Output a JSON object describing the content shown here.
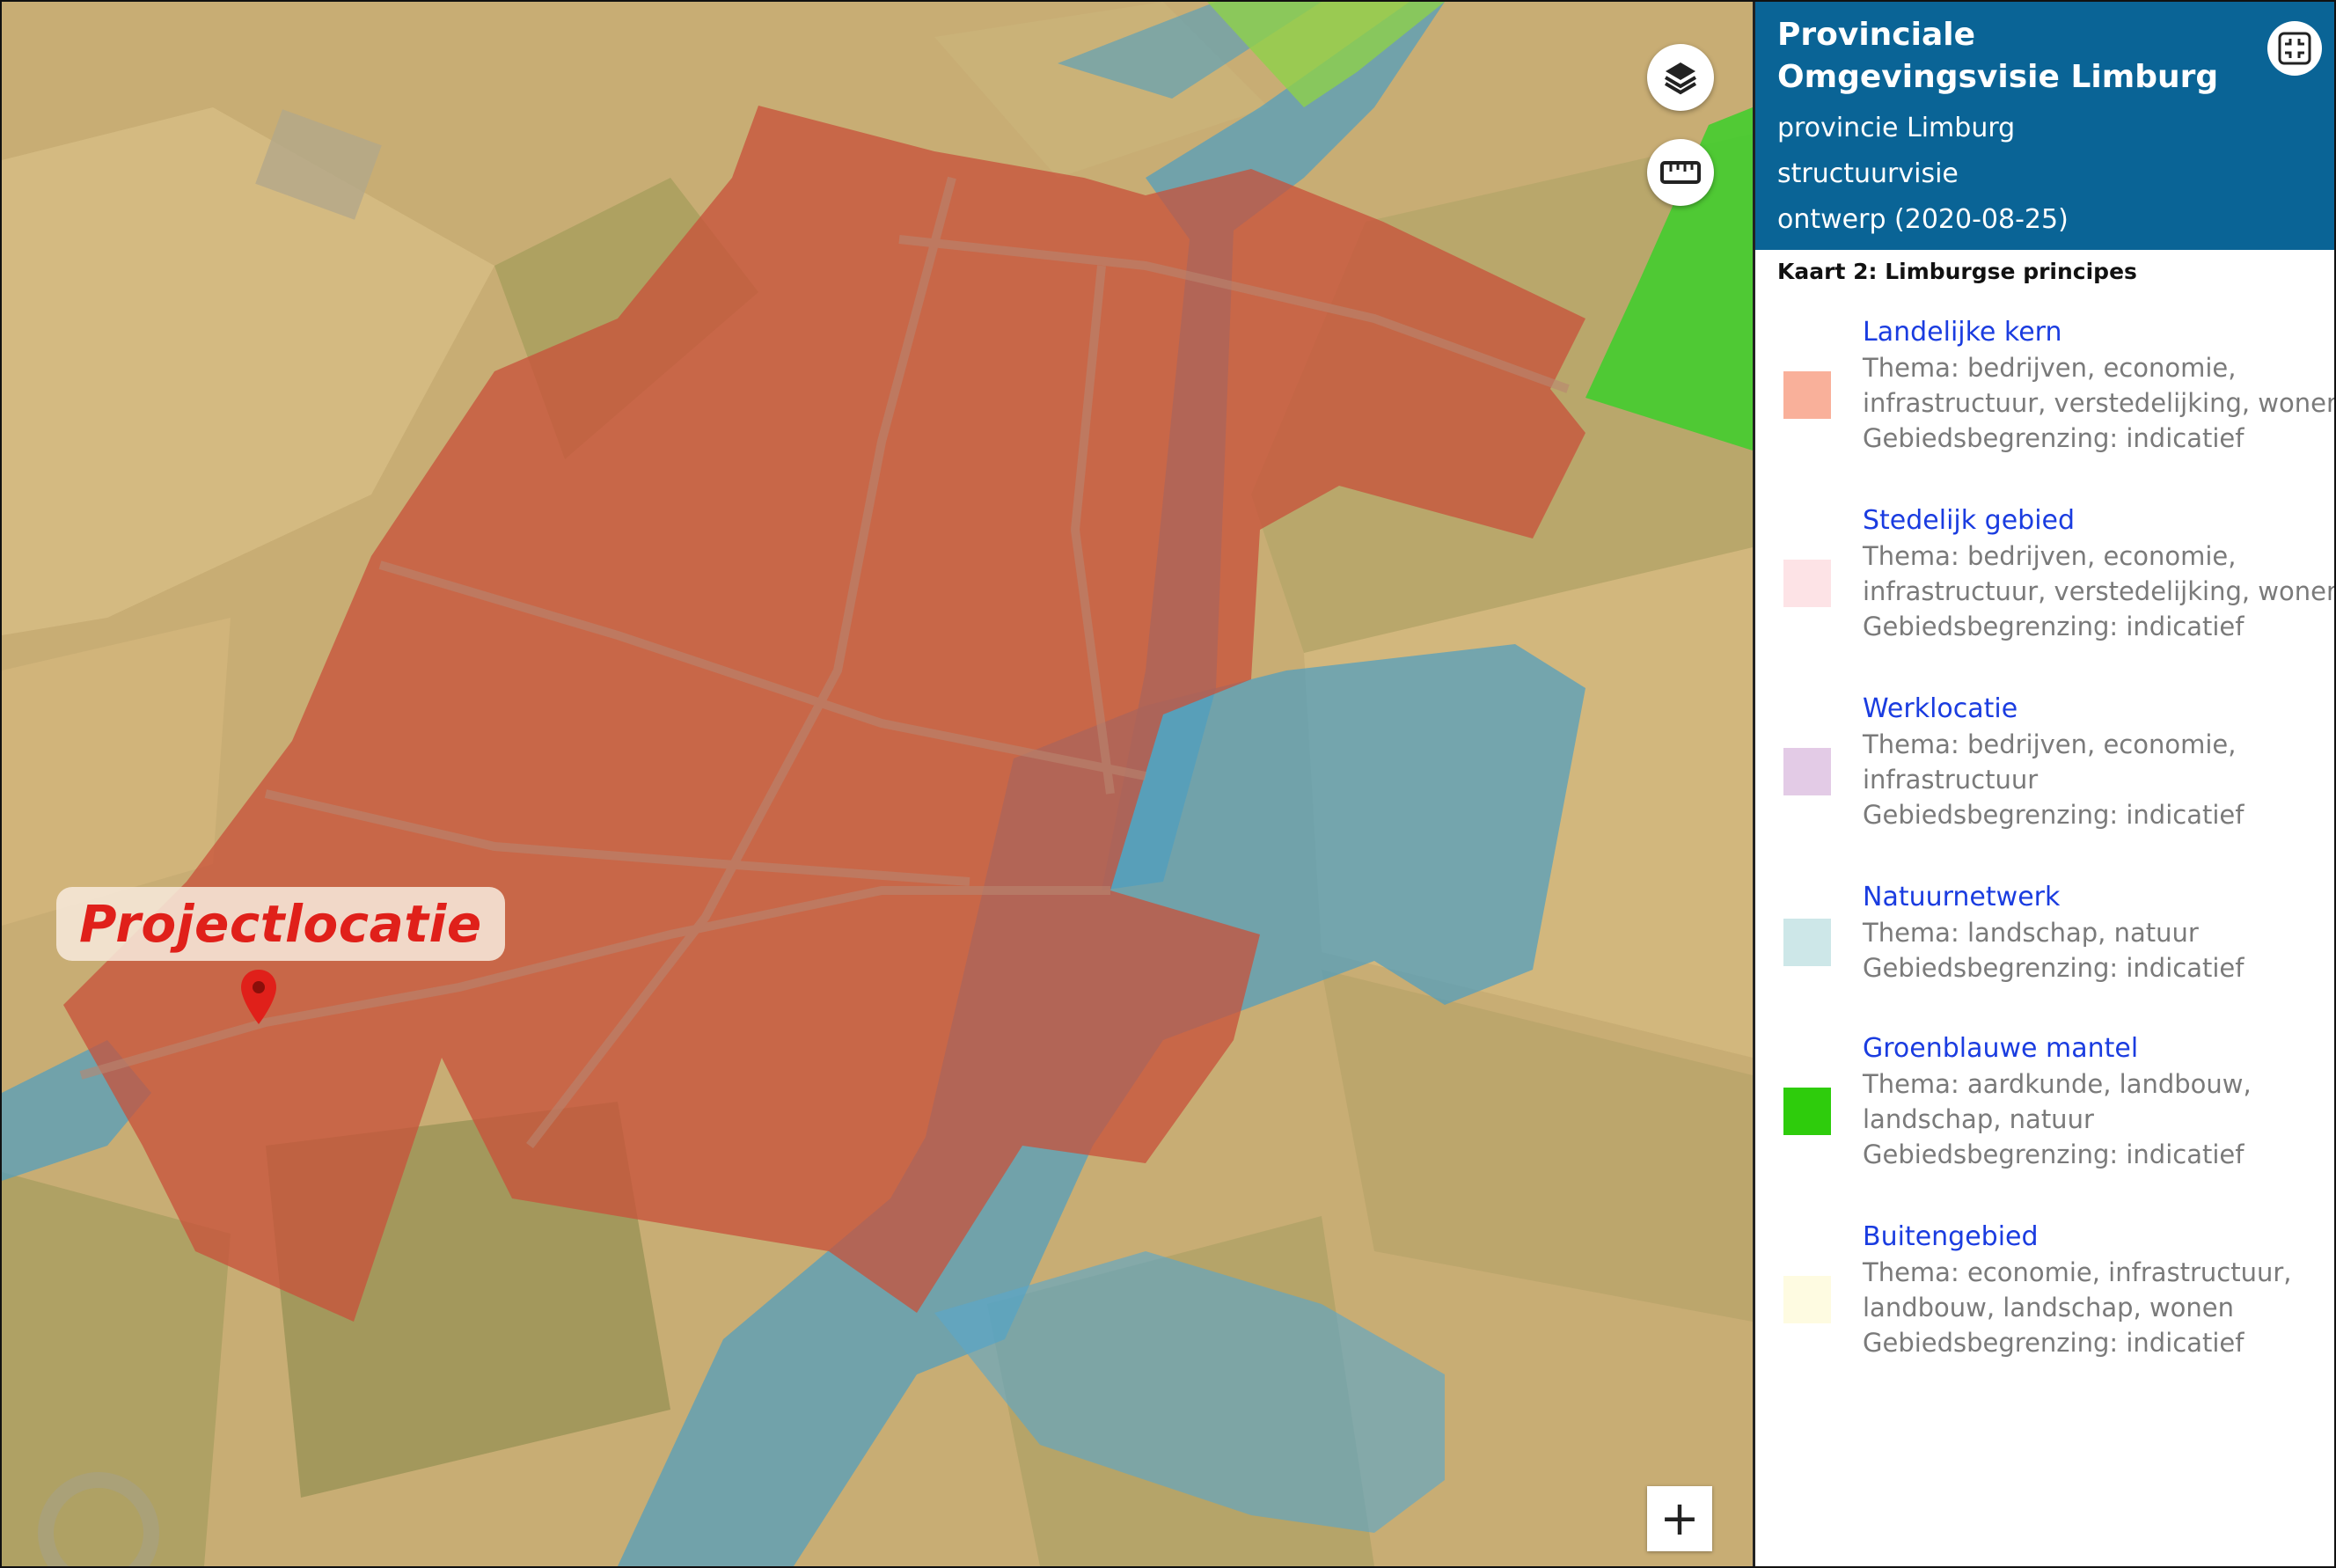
{
  "map": {
    "project_label": "Projectlocatie",
    "zoom_in_label": "+"
  },
  "panel": {
    "title": "Provinciale Omgevingsvisie Limburg",
    "authority": "provincie Limburg",
    "plan_type": "structuurvisie",
    "status": "ontwerp (2020-08-25)",
    "map_name": "Kaart 2: Limburgse principes",
    "legend": [
      {
        "title": "Landelijke kern",
        "lines": [
          "Thema: bedrijven, economie,",
          "infrastructuur, verstedelijking, wonen",
          "Gebiedsbegrenzing: indicatief"
        ],
        "color": "#f9b09a"
      },
      {
        "title": "Stedelijk gebied",
        "lines": [
          "Thema: bedrijven, economie,",
          "infrastructuur, verstedelijking, wonen",
          "Gebiedsbegrenzing: indicatief"
        ],
        "color": "#fde3e6"
      },
      {
        "title": "Werklocatie",
        "lines": [
          "Thema: bedrijven, economie,",
          "infrastructuur",
          "Gebiedsbegrenzing: indicatief"
        ],
        "color": "#e3cbe6"
      },
      {
        "title": "Natuurnetwerk",
        "lines": [
          "Thema: landschap, natuur",
          "Gebiedsbegrenzing: indicatief"
        ],
        "color": "#cde7e8"
      },
      {
        "title": "Groenblauwe mantel",
        "lines": [
          "Thema: aardkunde, landbouw,",
          "landschap, natuur",
          "Gebiedsbegrenzing: indicatief"
        ],
        "color": "#2ecc0c"
      },
      {
        "title": "Buitengebied",
        "lines": [
          "Thema: economie, infrastructuur,",
          "landbouw, landschap, wonen",
          "Gebiedsbegrenzing: indicatief"
        ],
        "color": "#fefbe1"
      }
    ]
  },
  "colors": {
    "header_bg": "#0a6496",
    "legend_link": "#1a3ce0",
    "legend_text": "#7a7a7a",
    "kern_overlay": "#c8503a",
    "natuur_overlay": "#4f9ebf",
    "mantel_overlay": "#3ccf2a",
    "buitengebied_overlay": "#c9ae72",
    "pin": "#e0201a"
  }
}
